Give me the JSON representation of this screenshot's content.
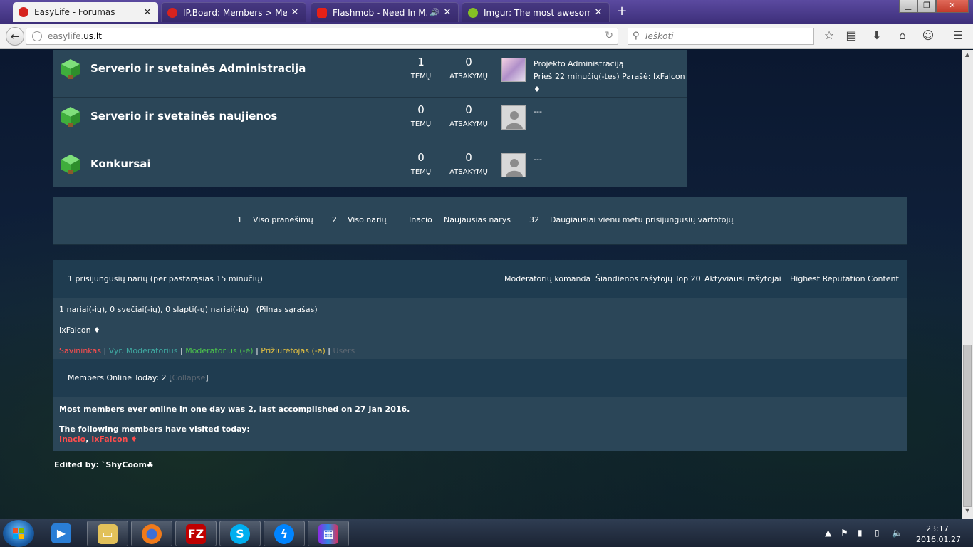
{
  "browser": {
    "tabs": [
      {
        "title": "EasyLife - Forumas",
        "active": true,
        "favicon_color": "#d6231e"
      },
      {
        "title": "IP.Board: Members > Mem...",
        "active": false,
        "favicon_color": "#d6231e"
      },
      {
        "title": "Flashmob - Need In M...",
        "active": false,
        "favicon_color": "#e62117"
      },
      {
        "title": "Imgur: The most awesome...",
        "active": false,
        "favicon_color": "#85bf25"
      }
    ],
    "url_prefix": "easylife.",
    "url_domain": "us.lt",
    "search_placeholder": "Ieškoti"
  },
  "forums": [
    {
      "name": "Serverio ir svetainės Administracija",
      "topics": "1",
      "topics_label": "TEMŲ",
      "replies": "0",
      "replies_label": "ATSAKYMŲ",
      "last_title": "Projėkto Administraciją",
      "last_meta": "Prieš 22 minučių(-tes) Parašė: IxFalcon ♦"
    },
    {
      "name": "Serverio ir svetainės naujienos",
      "topics": "0",
      "topics_label": "TEMŲ",
      "replies": "0",
      "replies_label": "ATSAKYMŲ",
      "last_title": "---",
      "last_meta": ""
    },
    {
      "name": "Konkursai",
      "topics": "0",
      "topics_label": "TEMŲ",
      "replies": "0",
      "replies_label": "ATSAKYMŲ",
      "last_title": "---",
      "last_meta": ""
    }
  ],
  "stats": {
    "posts_value": "1",
    "posts_label": "Viso pranešimų",
    "members_value": "2",
    "members_label": "Viso narių",
    "newest_value": "Inacio",
    "newest_label": "Naujausias narys",
    "max_value": "32",
    "max_label": "Daugiausiai vienu metu prisijungusių vartotojų"
  },
  "online": {
    "title": "1 prisijungusių narių (per pastarąsias 15 minučių)",
    "links": [
      "Moderatorių komanda",
      "Šiandienos rašytojų Top 20",
      "Aktyviausi rašytojai",
      "Highest Reputation Content"
    ],
    "summary": "1 nariai(-ių), 0 svečiai(-ių), 0 slapti(-ų) nariai(-ių)",
    "full_list": "(Pilnas sąrašas)",
    "online_user": "IxFalcon ♦",
    "legend": {
      "owner": "Savininkas",
      "senior_mod": "Vyr. Moderatorius",
      "mod": "Moderatorius (-ė)",
      "supervisor": "Prižiūrėtojas (-a)",
      "users": "Users",
      "sep": "|"
    }
  },
  "today": {
    "prefix": "Members Online Today: 2 [",
    "collapse": "Collapse",
    "suffix": "]",
    "record": "Most members ever online in one day was 2, last accomplished on 27 Jan 2016.",
    "visited_label": "The following members have visited today:",
    "visitor_1": "Inacio",
    "visitor_sep": ",",
    "visitor_2": "IxFalcon ♦"
  },
  "signature": "Edited by: `ShyCoom♣",
  "taskbar": {
    "time": "23:17",
    "date": "2016.01.27"
  }
}
